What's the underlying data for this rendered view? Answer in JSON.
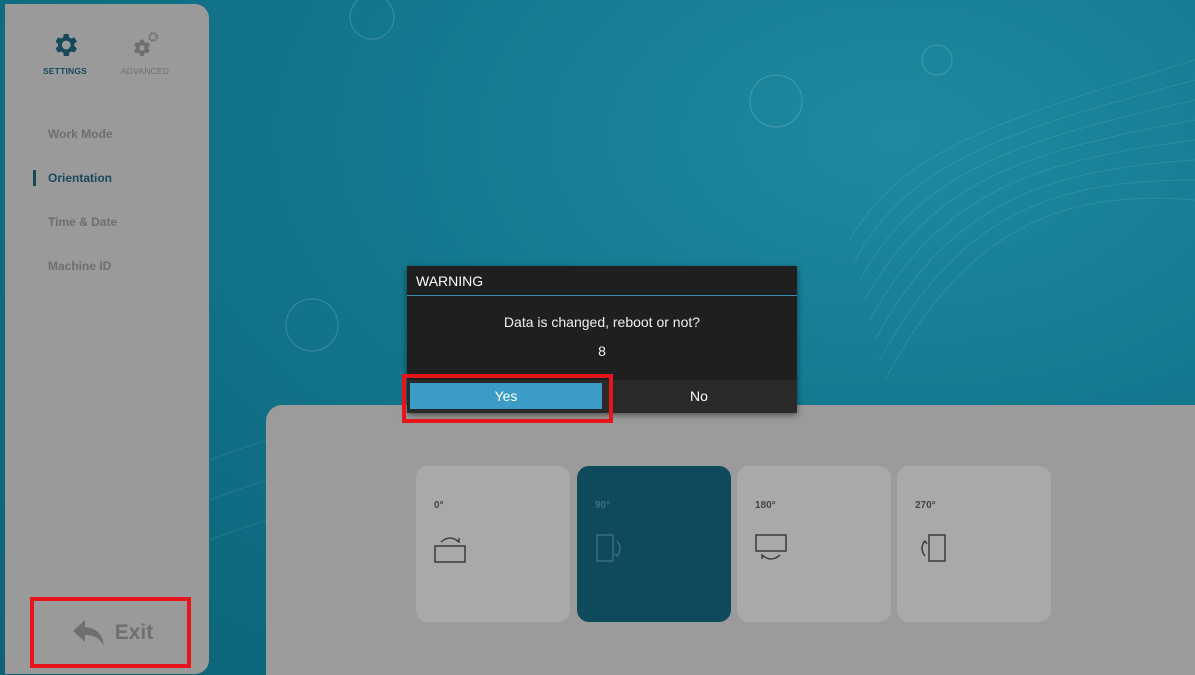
{
  "sidebar": {
    "tabs": [
      {
        "label": "SETTINGS",
        "icon": "gear-icon",
        "active": true
      },
      {
        "label": "ADVANCED",
        "icon": "gears-icon",
        "active": false
      }
    ],
    "items": [
      {
        "label": "Work Mode",
        "active": false
      },
      {
        "label": "Orientation",
        "active": true
      },
      {
        "label": "Time & Date",
        "active": false
      },
      {
        "label": "Machine ID",
        "active": false
      }
    ],
    "exit_label": "Exit",
    "exit_icon": "back-arrow-icon"
  },
  "orientation": {
    "options": [
      {
        "label": "0°",
        "icon": "rotate-0-icon",
        "selected": false
      },
      {
        "label": "90°",
        "icon": "rotate-90-icon",
        "selected": true
      },
      {
        "label": "180°",
        "icon": "rotate-180-icon",
        "selected": false
      },
      {
        "label": "270°",
        "icon": "rotate-270-icon",
        "selected": false
      }
    ]
  },
  "dialog": {
    "title": "WARNING",
    "message": "Data is changed, reboot or not?",
    "countdown": "8",
    "yes_label": "Yes",
    "no_label": "No"
  },
  "colors": {
    "accent": "#3b9cc8",
    "background": "#13788f",
    "selected_card": "#0f4a5c",
    "highlight": "#e8141c"
  }
}
